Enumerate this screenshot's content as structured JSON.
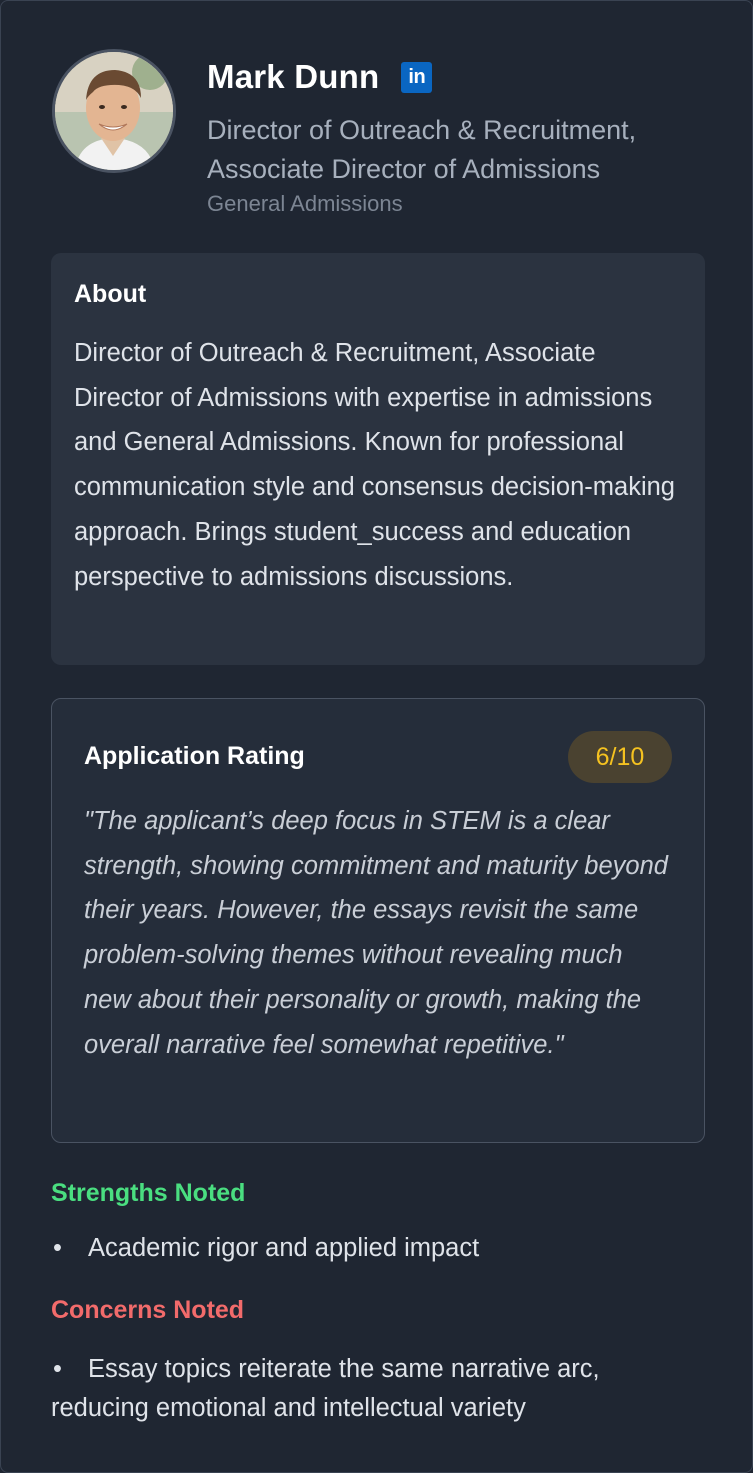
{
  "profile": {
    "name": "Mark Dunn",
    "title": "Director of Outreach & Recruitment, Associate Director of Admissions",
    "department": "General Admissions",
    "linkedin_icon": "linkedin-icon",
    "linkedin_label": "in",
    "avatar_icon": "profile-photo"
  },
  "about": {
    "heading": "About",
    "text": "Director of Outreach & Recruitment, Associate Director of Admissions with expertise in admissions and General Admissions. Known for professional communication style and consensus decision-making approach. Brings student_success and education perspective to admissions discussions."
  },
  "rating": {
    "heading": "Application Rating",
    "score": "6/10",
    "quote": "\"The applicant’s deep focus in STEM is a clear strength, showing commitment and maturity beyond their years. However, the essays revisit the same problem-solving themes without revealing much new about their personality or growth, making the overall narrative feel somewhat repetitive.\""
  },
  "strengths": {
    "heading": "Strengths Noted",
    "items": [
      "Academic rigor and applied impact"
    ]
  },
  "concerns": {
    "heading": "Concerns Noted",
    "items": [
      "Essay topics reiterate the same narrative arc, reducing emotional and intellectual variety"
    ]
  },
  "bullet": "•",
  "colors": {
    "background": "#1f2632",
    "panel": "#2b3340",
    "linkedin": "#0a66c2",
    "rating_badge_bg": "#4a4230",
    "rating_badge_text": "#f5c220",
    "strengths": "#4ade80",
    "concerns": "#f26b6b"
  }
}
